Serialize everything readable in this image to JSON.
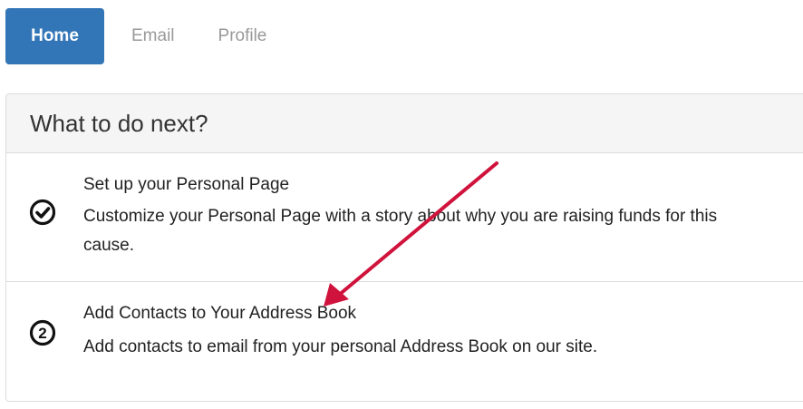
{
  "nav": {
    "tabs": [
      {
        "label": "Home",
        "active": true
      },
      {
        "label": "Email",
        "active": false
      },
      {
        "label": "Profile",
        "active": false
      }
    ]
  },
  "panel": {
    "heading": "What to do next?",
    "tasks": [
      {
        "status": "completed",
        "icon": "check-circle-icon",
        "title": "Set up your Personal Page",
        "description": "Customize your Personal Page with a story about why you are raising funds for this cause."
      },
      {
        "status": "pending",
        "step": "2",
        "icon": "number-2-circle-icon",
        "title": "Add Contacts to Your Address Book",
        "description": "Add contacts to email from your personal Address Book on our site."
      }
    ]
  },
  "colors": {
    "active_tab": "#3376b7",
    "inactive_tab_text": "#999999",
    "panel_head_bg": "#f5f5f5",
    "border": "#dcdcdc",
    "annotation_arrow": "#d0133c"
  }
}
